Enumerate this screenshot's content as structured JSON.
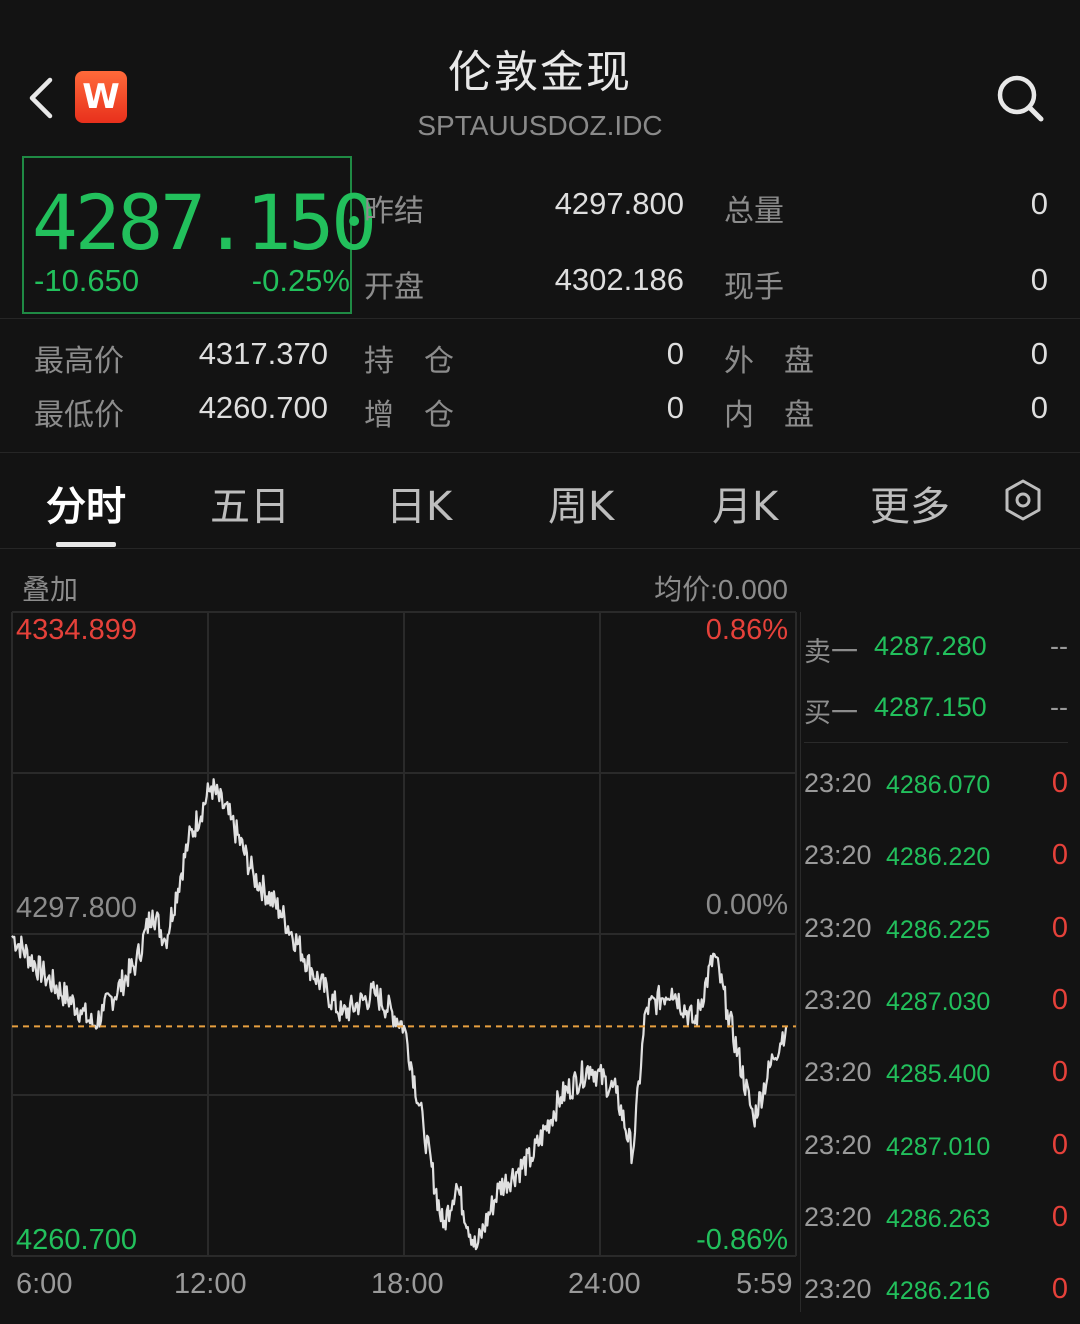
{
  "header": {
    "title": "伦敦金现",
    "subtitle": "SPTAUUSDOZ.IDC",
    "logo_text": "W"
  },
  "quote": {
    "price": "4287.150",
    "change": "-10.650",
    "change_pct": "-0.25%",
    "stats_top": [
      {
        "label": "昨结",
        "value": "4297.800"
      },
      {
        "label": "开盘",
        "value": "4302.186"
      },
      {
        "label": "总量",
        "value": "0"
      },
      {
        "label": "现手",
        "value": "0"
      }
    ],
    "stats_bottom": [
      {
        "label": "最高价",
        "value": "4317.370"
      },
      {
        "label": "最低价",
        "value": "4260.700"
      },
      {
        "label": "持　仓",
        "value": "0"
      },
      {
        "label": "增　仓",
        "value": "0"
      },
      {
        "label": "外　盘",
        "value": "0"
      },
      {
        "label": "内　盘",
        "value": "0"
      }
    ]
  },
  "tabs": [
    "分时",
    "五日",
    "日K",
    "周K",
    "月K",
    "更多"
  ],
  "chart_header": {
    "overlay_label": "叠加",
    "avg_price": "均价:0.000"
  },
  "chart_data": {
    "type": "line",
    "y_labels": {
      "top": "4334.899",
      "mid": "4297.800",
      "bottom": "4260.700"
    },
    "pct_labels": {
      "top": "0.86%",
      "mid": "0.00%",
      "bottom": "-0.86%"
    },
    "x_ticks": [
      "6:00",
      "12:00",
      "18:00",
      "24:00",
      "5:59"
    ],
    "ylim": [
      4260.7,
      4334.899
    ],
    "reference_price": 4297.8,
    "current_price": 4287.15,
    "keypoints": [
      {
        "t": 0.0,
        "p": 4297.6
      },
      {
        "t": 1.0,
        "p": 4293.0
      },
      {
        "t": 2.1,
        "p": 4289.0
      },
      {
        "t": 2.5,
        "p": 4287.2
      },
      {
        "t": 2.8,
        "p": 4289.0
      },
      {
        "t": 3.8,
        "p": 4294.5
      },
      {
        "t": 4.3,
        "p": 4300.5
      },
      {
        "t": 4.7,
        "p": 4297.0
      },
      {
        "t": 5.4,
        "p": 4308.5
      },
      {
        "t": 6.1,
        "p": 4314.8
      },
      {
        "t": 6.7,
        "p": 4311.0
      },
      {
        "t": 7.4,
        "p": 4304.5
      },
      {
        "t": 8.2,
        "p": 4300.5
      },
      {
        "t": 9.2,
        "p": 4293.5
      },
      {
        "t": 10.1,
        "p": 4288.5
      },
      {
        "t": 11.1,
        "p": 4291.0
      },
      {
        "t": 12.0,
        "p": 4287.2
      },
      {
        "t": 12.6,
        "p": 4275.5
      },
      {
        "t": 13.2,
        "p": 4264.0
      },
      {
        "t": 13.6,
        "p": 4269.0
      },
      {
        "t": 14.2,
        "p": 4261.5
      },
      {
        "t": 14.9,
        "p": 4268.5
      },
      {
        "t": 15.9,
        "p": 4272.0
      },
      {
        "t": 16.8,
        "p": 4279.0
      },
      {
        "t": 17.7,
        "p": 4282.5
      },
      {
        "t": 18.5,
        "p": 4279.5
      },
      {
        "t": 19.0,
        "p": 4272.5
      },
      {
        "t": 19.4,
        "p": 4289.0
      },
      {
        "t": 20.2,
        "p": 4291.5
      },
      {
        "t": 20.9,
        "p": 4287.5
      },
      {
        "t": 21.5,
        "p": 4295.5
      },
      {
        "t": 21.9,
        "p": 4289.0
      },
      {
        "t": 22.7,
        "p": 4276.5
      },
      {
        "t": 23.3,
        "p": 4283.5
      },
      {
        "t": 23.7,
        "p": 4287.2
      }
    ],
    "grid": true
  },
  "order_book": [
    {
      "label": "卖一",
      "price": "4287.280",
      "volume": "--"
    },
    {
      "label": "买一",
      "price": "4287.150",
      "volume": "--"
    }
  ],
  "trades": [
    {
      "time": "23:20",
      "price": "4286.070",
      "volume": "0"
    },
    {
      "time": "23:20",
      "price": "4286.220",
      "volume": "0"
    },
    {
      "time": "23:20",
      "price": "4286.225",
      "volume": "0"
    },
    {
      "time": "23:20",
      "price": "4287.030",
      "volume": "0"
    },
    {
      "time": "23:20",
      "price": "4285.400",
      "volume": "0"
    },
    {
      "time": "23:20",
      "price": "4287.010",
      "volume": "0"
    },
    {
      "time": "23:20",
      "price": "4286.263",
      "volume": "0"
    },
    {
      "time": "23:20",
      "price": "4286.216",
      "volume": "0"
    }
  ],
  "colors": {
    "up": "#e5413a",
    "down": "#22c05c",
    "avg_line": "#e8a040",
    "grid": "#2a2a2a"
  }
}
